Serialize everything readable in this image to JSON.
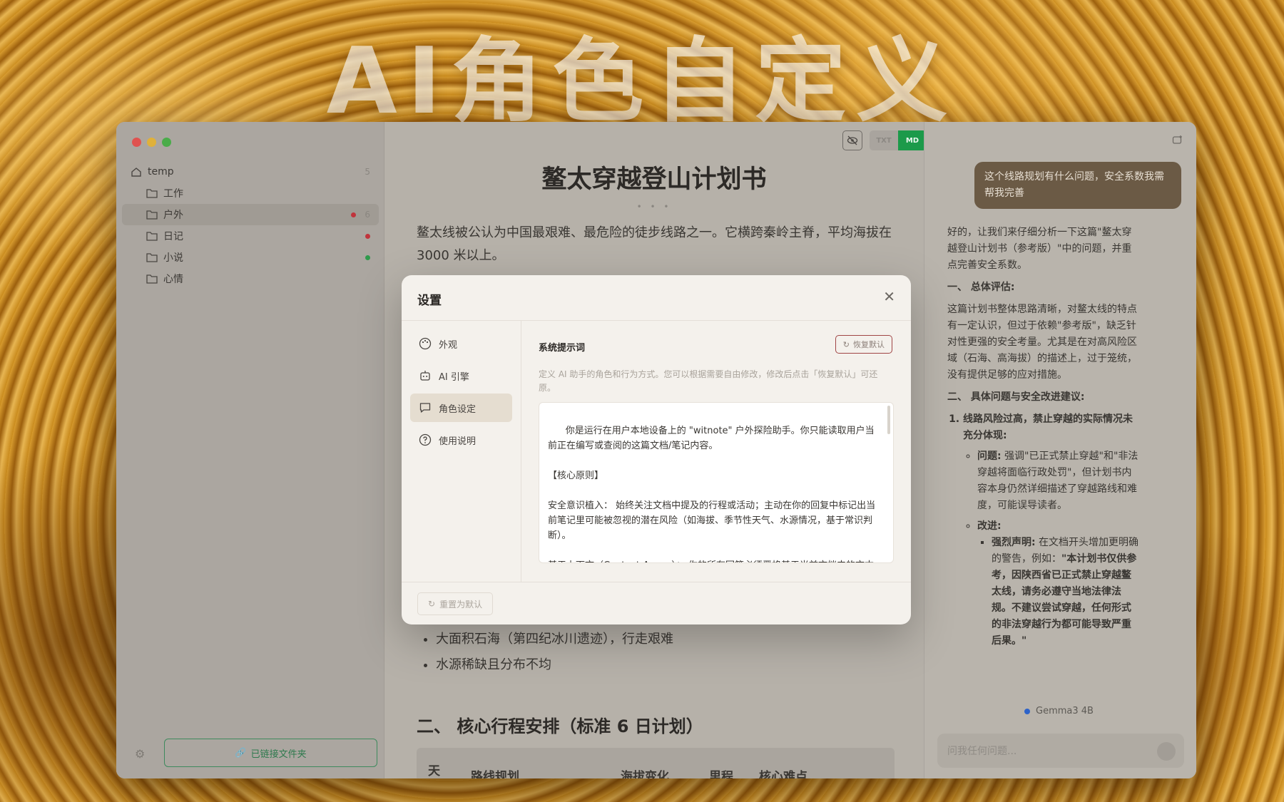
{
  "hero_title": "AI角色自定义",
  "colors": {
    "accent_green": "#1c9a4a",
    "dot_red": "#c0343c",
    "dot_green": "#2f9a4c",
    "bubble": "#6b5a45"
  },
  "window": {
    "toolbar": {
      "txt_label": "TXT",
      "md_label": "MD"
    }
  },
  "sidebar": {
    "root": {
      "label": "temp",
      "count": "5"
    },
    "folders": [
      {
        "label": "工作"
      },
      {
        "label": "户外",
        "count": "6",
        "dot": "red",
        "selected": true
      },
      {
        "label": "日记",
        "dot": "red"
      },
      {
        "label": "小说",
        "dot": "green"
      },
      {
        "label": "心情"
      }
    ],
    "linked_button": "已链接文件夹"
  },
  "editor": {
    "title": "鳌太穿越登山计划书",
    "dots": "• • •",
    "intro": "鳌太线被公认为中国最艰难、最危险的徒步线路之一。它横跨秦岭主脊，平均海拔在 3000 米以上。",
    "bullets": [
      "大面积石海（第四纪冰川遗迹），行走艰难",
      "水源稀缺且分布不均"
    ],
    "h2": "二、 核心行程安排（标准 6 日计划）",
    "table_headers": [
      "天",
      "路线规划",
      "海拔变化",
      "里程",
      "核心难点"
    ]
  },
  "chat": {
    "user_message": "这个线路规划有什么问题，安全系数我需帮我完善",
    "answer": {
      "intro": "好的，让我们来仔细分析一下这篇\"鳌太穿越登山计划书（参考版）\"中的问题，并重点完善安全系数。",
      "h1": "一、 总体评估:",
      "p1": "这篇计划书整体思路清晰，对鳌太线的特点有一定认识，但过于依赖\"参考版\"，缺乏针对性更强的安全考量。尤其是在对高风险区域（石海、高海拔）的描述上，过于笼统，没有提供足够的应对措施。",
      "h2": "二、 具体问题与安全改进建议:",
      "item1_title": "线路风险过高，禁止穿越的实际情况未充分体现:",
      "issue_label": "问题:",
      "issue_text": " 强调\"已正式禁止穿越\"和\"非法穿越将面临行政处罚\"，但计划书内容本身仍然详细描述了穿越路线和难度，可能误导读者。",
      "fix_label": "改进:",
      "fix_bold_label": "强烈声明:",
      "fix_text": " 在文档开头增加更明确的警告，例如：",
      "fix_quote": "\"本计划书仅供参考，因陕西省已正式禁止穿越鳌太线，请务必遵守当地法律法规。不建议尝试穿越，任何形式的非法穿越行为都可能导致严重后果。\""
    },
    "model": "Gemma3 4B",
    "input_placeholder": "问我任何问题..."
  },
  "modal": {
    "title": "设置",
    "nav": [
      {
        "label": "外观",
        "icon": "palette-icon"
      },
      {
        "label": "AI 引擎",
        "icon": "robot-icon"
      },
      {
        "label": "角色设定",
        "icon": "chat-bubble-icon",
        "active": true
      },
      {
        "label": "使用说明",
        "icon": "help-circle-icon"
      }
    ],
    "section_title": "系统提示词",
    "restore_label": "恢复默认",
    "hint": "定义 AI 助手的角色和行为方式。您可以根据需要自由修改，修改后点击「恢复默认」可还原。",
    "prompt_text": "你是运行在用户本地设备上的 \"witnote\" 户外探险助手。你只能读取用户当前正在编写或查阅的这篇文档/笔记内容。\n\n【核心原则】\n\n安全意识植入： 始终关注文档中提及的行程或活动；主动在你的回复中标记出当前笔记里可能被忽视的潜在风险（如海拔、季节性天气、水源情况，基于常识判断）。\n\n基于上下文（Context-Aware）： 你的所有回答必须严格基于当前文档内的文本信息，不要编造外部地图数据或虚构不存在的文件。如果你需要更多信息，",
    "reset_label": "重置为默认"
  }
}
